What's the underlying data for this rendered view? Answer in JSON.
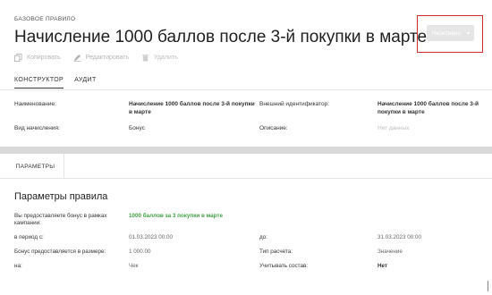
{
  "header": {
    "eyebrow": "БАЗОВОЕ ПРАВИЛО",
    "title": "Начисление 1000 баллов после 3-й покупки в марте"
  },
  "status": {
    "label": "Неактивно",
    "highlight_color": "#d32f2f"
  },
  "actions": [
    {
      "label": "Копировать",
      "icon": "copy-icon"
    },
    {
      "label": "Редактировать",
      "icon": "pencil-icon"
    },
    {
      "label": "Удалить",
      "icon": "trash-icon"
    }
  ],
  "tabs": [
    {
      "label": "КОНСТРУКТОР",
      "active": true
    },
    {
      "label": "АУДИТ",
      "active": false
    }
  ],
  "info": {
    "name_label": "Наименование:",
    "name_value": "Начисление 1000 баллов после 3-й покупки в марте",
    "external_id_label": "Внешний идентификатор:",
    "external_id_value": "Начисление 1000 баллов после 3-й покупки в марте",
    "accrual_type_label": "Вид начисления:",
    "accrual_type_value": "Бонус",
    "description_label": "Описание:",
    "description_value": "Нет данных"
  },
  "params_tab": "ПАРАМЕТРЫ",
  "section_title": "Параметры правила",
  "params": {
    "campaign_label": "Вы предоставляете бонус в рамках кампании:",
    "campaign_value": "1000 баллов за 3 покупки в марте",
    "period_from_label": "в период с:",
    "period_from_value": "01.03.2023 00:00",
    "period_to_label": "до:",
    "period_to_value": "31.03.2023 00:00",
    "bonus_size_label": "Бонус предоставляется в размере:",
    "bonus_size_value": "1 000.00",
    "calc_type_label": "Тип расчета:",
    "calc_type_value": "Значение",
    "on_label": "на:",
    "on_value": "Чек",
    "consider_label": "Учитывать состав:",
    "consider_value": "Нет"
  }
}
